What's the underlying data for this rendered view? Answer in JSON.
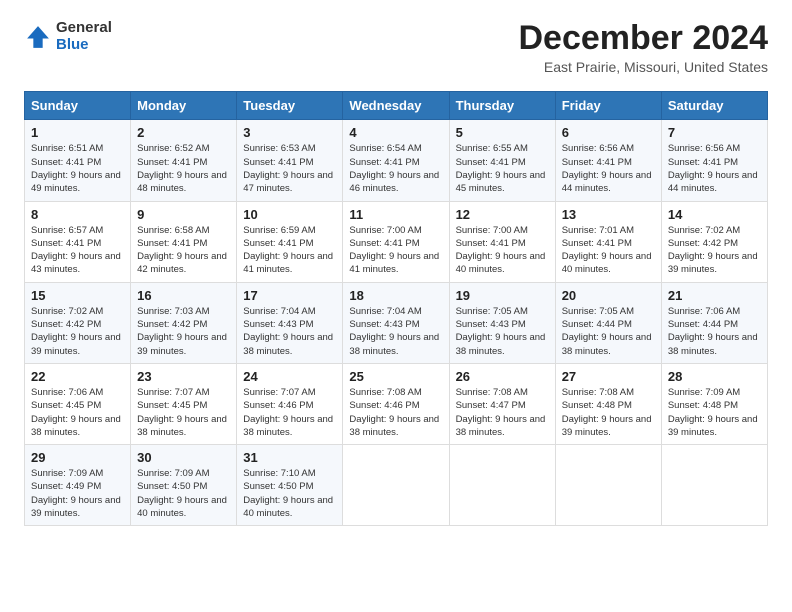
{
  "logo": {
    "general": "General",
    "blue": "Blue"
  },
  "title": "December 2024",
  "location": "East Prairie, Missouri, United States",
  "headers": [
    "Sunday",
    "Monday",
    "Tuesday",
    "Wednesday",
    "Thursday",
    "Friday",
    "Saturday"
  ],
  "weeks": [
    [
      {
        "day": "1",
        "sunrise": "6:51 AM",
        "sunset": "4:41 PM",
        "daylight": "9 hours and 49 minutes."
      },
      {
        "day": "2",
        "sunrise": "6:52 AM",
        "sunset": "4:41 PM",
        "daylight": "9 hours and 48 minutes."
      },
      {
        "day": "3",
        "sunrise": "6:53 AM",
        "sunset": "4:41 PM",
        "daylight": "9 hours and 47 minutes."
      },
      {
        "day": "4",
        "sunrise": "6:54 AM",
        "sunset": "4:41 PM",
        "daylight": "9 hours and 46 minutes."
      },
      {
        "day": "5",
        "sunrise": "6:55 AM",
        "sunset": "4:41 PM",
        "daylight": "9 hours and 45 minutes."
      },
      {
        "day": "6",
        "sunrise": "6:56 AM",
        "sunset": "4:41 PM",
        "daylight": "9 hours and 44 minutes."
      },
      {
        "day": "7",
        "sunrise": "6:56 AM",
        "sunset": "4:41 PM",
        "daylight": "9 hours and 44 minutes."
      }
    ],
    [
      {
        "day": "8",
        "sunrise": "6:57 AM",
        "sunset": "4:41 PM",
        "daylight": "9 hours and 43 minutes."
      },
      {
        "day": "9",
        "sunrise": "6:58 AM",
        "sunset": "4:41 PM",
        "daylight": "9 hours and 42 minutes."
      },
      {
        "day": "10",
        "sunrise": "6:59 AM",
        "sunset": "4:41 PM",
        "daylight": "9 hours and 41 minutes."
      },
      {
        "day": "11",
        "sunrise": "7:00 AM",
        "sunset": "4:41 PM",
        "daylight": "9 hours and 41 minutes."
      },
      {
        "day": "12",
        "sunrise": "7:00 AM",
        "sunset": "4:41 PM",
        "daylight": "9 hours and 40 minutes."
      },
      {
        "day": "13",
        "sunrise": "7:01 AM",
        "sunset": "4:41 PM",
        "daylight": "9 hours and 40 minutes."
      },
      {
        "day": "14",
        "sunrise": "7:02 AM",
        "sunset": "4:42 PM",
        "daylight": "9 hours and 39 minutes."
      }
    ],
    [
      {
        "day": "15",
        "sunrise": "7:02 AM",
        "sunset": "4:42 PM",
        "daylight": "9 hours and 39 minutes."
      },
      {
        "day": "16",
        "sunrise": "7:03 AM",
        "sunset": "4:42 PM",
        "daylight": "9 hours and 39 minutes."
      },
      {
        "day": "17",
        "sunrise": "7:04 AM",
        "sunset": "4:43 PM",
        "daylight": "9 hours and 38 minutes."
      },
      {
        "day": "18",
        "sunrise": "7:04 AM",
        "sunset": "4:43 PM",
        "daylight": "9 hours and 38 minutes."
      },
      {
        "day": "19",
        "sunrise": "7:05 AM",
        "sunset": "4:43 PM",
        "daylight": "9 hours and 38 minutes."
      },
      {
        "day": "20",
        "sunrise": "7:05 AM",
        "sunset": "4:44 PM",
        "daylight": "9 hours and 38 minutes."
      },
      {
        "day": "21",
        "sunrise": "7:06 AM",
        "sunset": "4:44 PM",
        "daylight": "9 hours and 38 minutes."
      }
    ],
    [
      {
        "day": "22",
        "sunrise": "7:06 AM",
        "sunset": "4:45 PM",
        "daylight": "9 hours and 38 minutes."
      },
      {
        "day": "23",
        "sunrise": "7:07 AM",
        "sunset": "4:45 PM",
        "daylight": "9 hours and 38 minutes."
      },
      {
        "day": "24",
        "sunrise": "7:07 AM",
        "sunset": "4:46 PM",
        "daylight": "9 hours and 38 minutes."
      },
      {
        "day": "25",
        "sunrise": "7:08 AM",
        "sunset": "4:46 PM",
        "daylight": "9 hours and 38 minutes."
      },
      {
        "day": "26",
        "sunrise": "7:08 AM",
        "sunset": "4:47 PM",
        "daylight": "9 hours and 38 minutes."
      },
      {
        "day": "27",
        "sunrise": "7:08 AM",
        "sunset": "4:48 PM",
        "daylight": "9 hours and 39 minutes."
      },
      {
        "day": "28",
        "sunrise": "7:09 AM",
        "sunset": "4:48 PM",
        "daylight": "9 hours and 39 minutes."
      }
    ],
    [
      {
        "day": "29",
        "sunrise": "7:09 AM",
        "sunset": "4:49 PM",
        "daylight": "9 hours and 39 minutes."
      },
      {
        "day": "30",
        "sunrise": "7:09 AM",
        "sunset": "4:50 PM",
        "daylight": "9 hours and 40 minutes."
      },
      {
        "day": "31",
        "sunrise": "7:10 AM",
        "sunset": "4:50 PM",
        "daylight": "9 hours and 40 minutes."
      },
      null,
      null,
      null,
      null
    ]
  ],
  "labels": {
    "sunrise": "Sunrise:",
    "sunset": "Sunset:",
    "daylight": "Daylight:"
  }
}
